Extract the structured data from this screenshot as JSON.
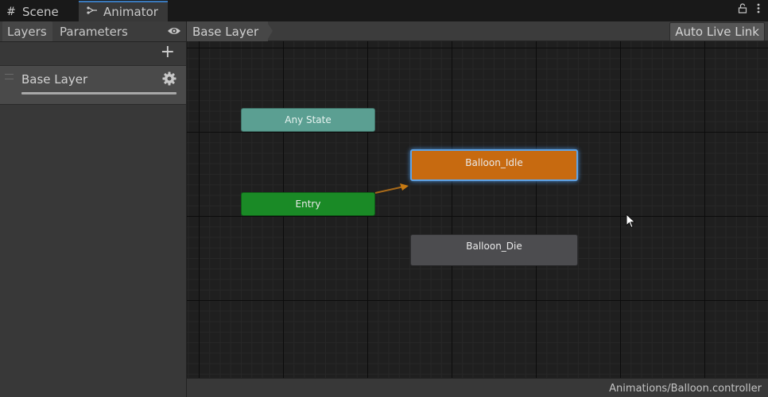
{
  "tabs": {
    "scene_label": "Scene",
    "animator_label": "Animator"
  },
  "left_panel": {
    "tab_layers": "Layers",
    "tab_parameters": "Parameters",
    "layer_name": "Base Layer"
  },
  "graph": {
    "breadcrumb": "Base Layer",
    "auto_live_link": "Auto Live Link",
    "nodes": {
      "any_state": "Any State",
      "entry": "Entry",
      "idle": "Balloon_Idle",
      "die": "Balloon_Die"
    }
  },
  "status": {
    "controller_path": "Animations/Balloon.controller"
  },
  "colors": {
    "any_state": "#5b9f92",
    "entry": "#1a8a26",
    "default_state": "#c76a10",
    "state": "#4c4c4f",
    "selection": "#5fa3e6"
  }
}
